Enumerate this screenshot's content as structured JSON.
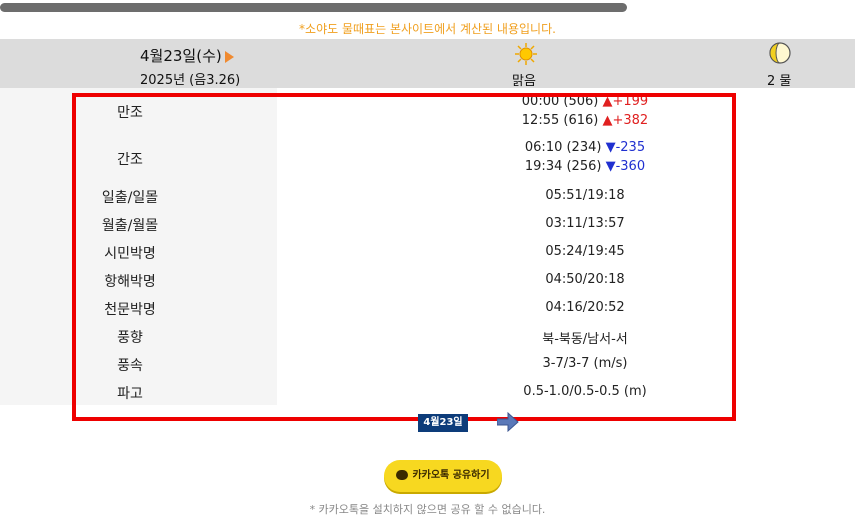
{
  "notice": "*소야도 물때표는 본사이트에서 계산된 내용입니다.",
  "header": {
    "date": "4월23일(수)",
    "lunar": "2025년 (음3.26)",
    "weather": "맑음",
    "tide": "2 물",
    "weather_icon": "sun-icon",
    "moon_icon": "half-moon-icon"
  },
  "rows": [
    {
      "label": "만조",
      "lines": [
        {
          "text": "00:00 (506)",
          "dir": "▲",
          "diff": "+199"
        },
        {
          "text": "12:55 (616)",
          "dir": "▲",
          "diff": "+382"
        }
      ]
    },
    {
      "label": "간조",
      "lines": [
        {
          "text": "06:10 (234)",
          "dir": "▼",
          "diff": "-235"
        },
        {
          "text": "19:34 (256)",
          "dir": "▼",
          "diff": "-360"
        }
      ]
    },
    {
      "label": "일출/일몰",
      "value": "05:51/19:18"
    },
    {
      "label": "월출/월몰",
      "value": "03:11/13:57"
    },
    {
      "label": "시민박명",
      "value": "05:24/19:45"
    },
    {
      "label": "항해박명",
      "value": "04:50/20:18"
    },
    {
      "label": "천문박명",
      "value": "04:16/20:52"
    },
    {
      "label": "풍향",
      "value": "북-북동/남서-서"
    },
    {
      "label": "풍속",
      "value": "3-7/3-7 (m/s)"
    },
    {
      "label": "파고",
      "value": "0.5-1.0/0.5-0.5 (m)"
    }
  ],
  "date_button": "4월23일",
  "kakao_button": "카카오톡 공유하기",
  "footnote": "* 카카오톡을 설치하지 않으면 공유 할 수 없습니다.",
  "colors": {
    "up": "#e02020",
    "down": "#2030d0",
    "highlight_box": "#ee0000",
    "notice": "#f0a020"
  }
}
